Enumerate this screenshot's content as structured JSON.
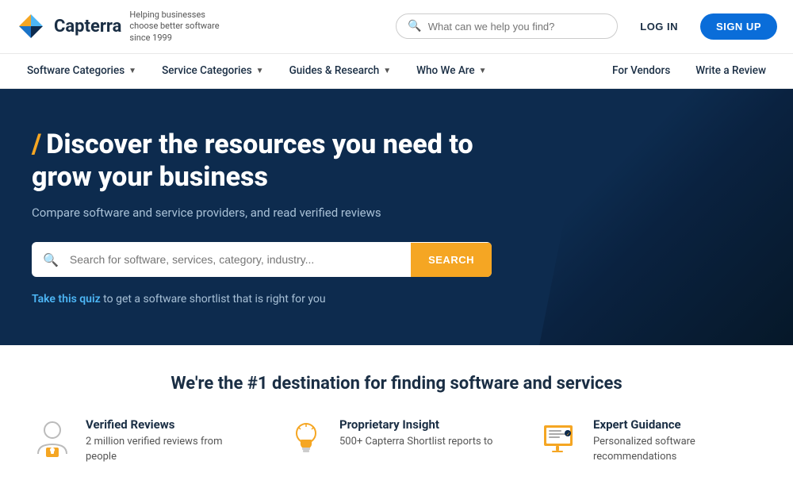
{
  "header": {
    "logo_text": "Capterra",
    "logo_tagline": "Helping businesses choose better software since 1999",
    "search_placeholder": "What can we help you find?",
    "btn_login": "LOG IN",
    "btn_signup": "SIGN UP"
  },
  "nav": {
    "left_items": [
      {
        "label": "Software Categories",
        "has_dropdown": true
      },
      {
        "label": "Service Categories",
        "has_dropdown": true
      },
      {
        "label": "Guides & Research",
        "has_dropdown": true
      },
      {
        "label": "Who We Are",
        "has_dropdown": true
      }
    ],
    "right_items": [
      {
        "label": "For Vendors"
      },
      {
        "label": "Write a Review"
      }
    ]
  },
  "hero": {
    "accent": "/",
    "title": "Discover the resources you need to grow your business",
    "subtitle": "Compare software and service providers, and read verified reviews",
    "search_placeholder": "Search for software, services, category, industry...",
    "search_btn": "SEARCH",
    "quiz_text": "Take this quiz",
    "quiz_suffix": " to get a software shortlist that is right for you"
  },
  "bottom": {
    "title": "We're the #1 destination for finding software and services",
    "features": [
      {
        "icon_name": "verified-reviews-icon",
        "heading": "Verified Reviews",
        "description": "2 million verified reviews from people"
      },
      {
        "icon_name": "proprietary-insight-icon",
        "heading": "Proprietary Insight",
        "description": "500+ Capterra Shortlist reports to"
      },
      {
        "icon_name": "expert-guidance-icon",
        "heading": "Expert Guidance",
        "description": "Personalized software recommendations"
      }
    ]
  }
}
